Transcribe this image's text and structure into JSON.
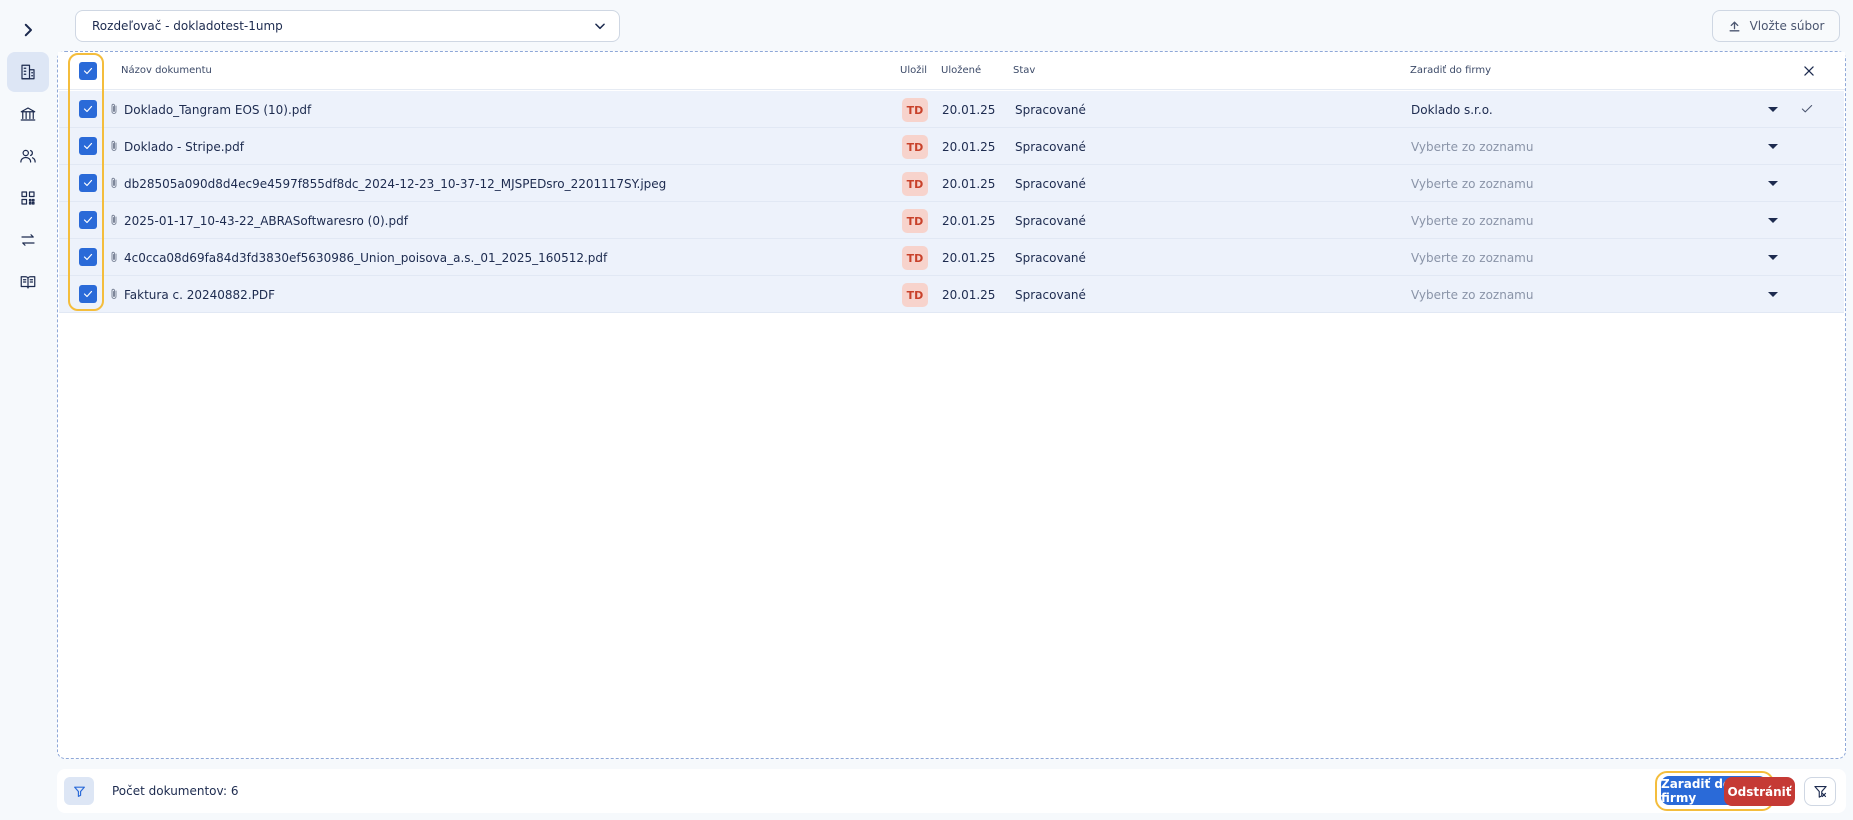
{
  "sidebar": {
    "items": [
      {
        "name": "expand-sidebar",
        "icon": "chevron-right-icon",
        "active": false
      },
      {
        "name": "companies",
        "icon": "building-icon",
        "active": true
      },
      {
        "name": "bank",
        "icon": "bank-icon",
        "active": false
      },
      {
        "name": "users",
        "icon": "users-icon",
        "active": false
      },
      {
        "name": "qr-codes",
        "icon": "qr-code-icon",
        "active": false
      },
      {
        "name": "transfers",
        "icon": "arrows-exchange-icon",
        "active": false
      },
      {
        "name": "guide",
        "icon": "book-icon",
        "active": false
      }
    ]
  },
  "header": {
    "splitter_select": "Rozdeľovač - dokladotest-1ump",
    "upload_label": "Vložte súbor"
  },
  "table": {
    "columns": {
      "name": "Názov dokumentu",
      "uploaded_by": "Uložil",
      "uploaded_at": "Uložené",
      "status": "Stav",
      "assign": "Zaradiť do firmy"
    },
    "all_selected": true,
    "rows": [
      {
        "checked": true,
        "filename": "Doklado_Tangram EOS (10).pdf",
        "uploader": "TD",
        "date": "20.01.25",
        "status": "Spracované",
        "company": "Doklado s.r.o.",
        "company_selected": true,
        "confirmed": true
      },
      {
        "checked": true,
        "filename": "Doklado - Stripe.pdf",
        "uploader": "TD",
        "date": "20.01.25",
        "status": "Spracované",
        "company": "Vyberte zo zoznamu",
        "company_selected": false,
        "confirmed": false
      },
      {
        "checked": true,
        "filename": "db28505a090d8d4ec9e4597f855df8dc_2024-12-23_10-37-12_MJSPEDsro_2201117SY.jpeg",
        "uploader": "TD",
        "date": "20.01.25",
        "status": "Spracované",
        "company": "Vyberte zo zoznamu",
        "company_selected": false,
        "confirmed": false
      },
      {
        "checked": true,
        "filename": "2025-01-17_10-43-22_ABRASoftwaresro (0).pdf",
        "uploader": "TD",
        "date": "20.01.25",
        "status": "Spracované",
        "company": "Vyberte zo zoznamu",
        "company_selected": false,
        "confirmed": false
      },
      {
        "checked": true,
        "filename": "4c0cca08d69fa84d3fd3830ef5630986_Union_poisova_a.s._01_2025_160512.pdf",
        "uploader": "TD",
        "date": "20.01.25",
        "status": "Spracované",
        "company": "Vyberte zo zoznamu",
        "company_selected": false,
        "confirmed": false
      },
      {
        "checked": true,
        "filename": "Faktura c. 20240882.PDF",
        "uploader": "TD",
        "date": "20.01.25",
        "status": "Spracované",
        "company": "Vyberte zo zoznamu",
        "company_selected": false,
        "confirmed": false
      }
    ]
  },
  "footer": {
    "count_label": "Počet dokumentov: 6",
    "assign_button": "Zaradiť do firmy",
    "remove_button": "Odstrániť"
  },
  "colors": {
    "accent": "#2a6ad8",
    "danger": "#c53a35",
    "highlight": "#f4bd3c",
    "row_selected": "#edf2fb"
  }
}
